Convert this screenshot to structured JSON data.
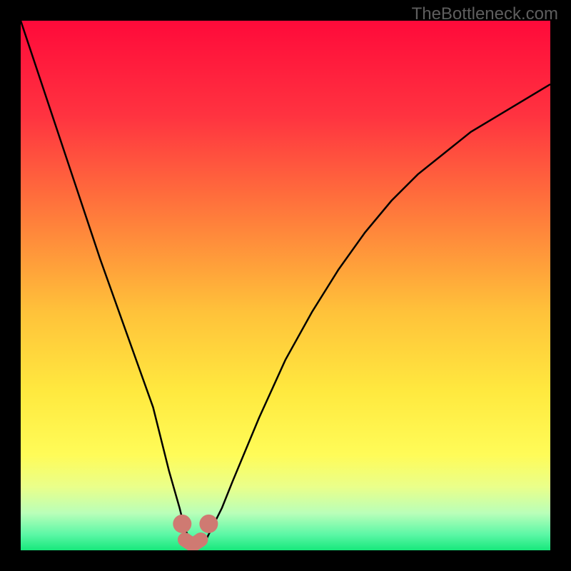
{
  "attribution": "TheBottleneck.com",
  "chart_data": {
    "type": "line",
    "title": "",
    "xlabel": "",
    "ylabel": "",
    "xlim": [
      0,
      100
    ],
    "ylim": [
      0,
      100
    ],
    "grid": false,
    "legend": false,
    "series": [
      {
        "name": "bottleneck-curve",
        "x": [
          0,
          5,
          10,
          15,
          20,
          25,
          28,
          30,
          31,
          32,
          33,
          34,
          35,
          36,
          38,
          40,
          45,
          50,
          55,
          60,
          65,
          70,
          75,
          80,
          85,
          90,
          95,
          100
        ],
        "values": [
          100,
          85,
          70,
          55,
          41,
          27,
          15,
          8,
          4,
          2,
          1,
          1,
          2,
          4,
          8,
          13,
          25,
          36,
          45,
          53,
          60,
          66,
          71,
          75,
          79,
          82,
          85,
          88
        ]
      }
    ],
    "markers": [
      {
        "name": "left-blob",
        "x": 30.5,
        "y": 5
      },
      {
        "name": "right-blob",
        "x": 35.5,
        "y": 5
      },
      {
        "name": "elbow-1",
        "x": 31.0,
        "y": 2.0
      },
      {
        "name": "elbow-2",
        "x": 32.5,
        "y": 1.0
      },
      {
        "name": "elbow-3",
        "x": 34.0,
        "y": 2.0
      }
    ],
    "background_gradient": {
      "stops": [
        {
          "offset": 0,
          "color": "#ff0a3a"
        },
        {
          "offset": 18,
          "color": "#ff3340"
        },
        {
          "offset": 38,
          "color": "#ff803b"
        },
        {
          "offset": 55,
          "color": "#ffc23a"
        },
        {
          "offset": 70,
          "color": "#ffe93f"
        },
        {
          "offset": 82,
          "color": "#fffc58"
        },
        {
          "offset": 88,
          "color": "#eaff8a"
        },
        {
          "offset": 93,
          "color": "#b9ffb9"
        },
        {
          "offset": 97,
          "color": "#5cf7a6"
        },
        {
          "offset": 100,
          "color": "#17e87b"
        }
      ]
    },
    "marker_color": "#cf7a72",
    "line_color": "#000000"
  }
}
